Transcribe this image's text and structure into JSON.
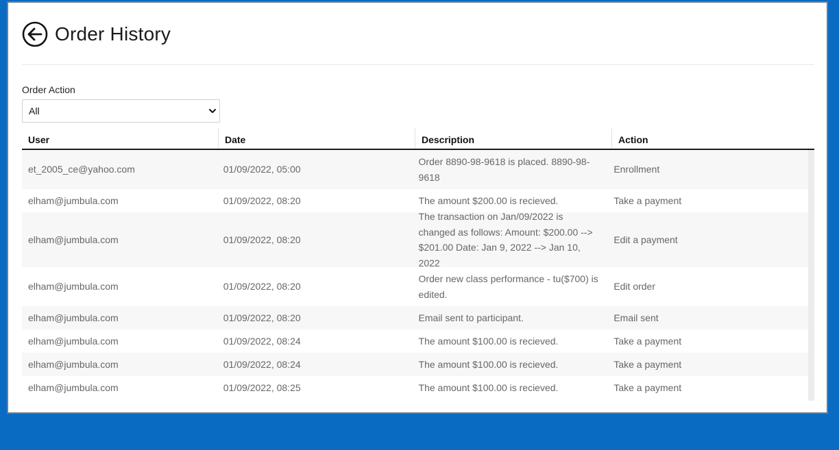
{
  "header": {
    "title": "Order History",
    "back_icon": "arrow-left-circle-icon"
  },
  "filter": {
    "label": "Order Action",
    "selected": "All"
  },
  "table": {
    "columns": [
      "User",
      "Date",
      "Description",
      "Action"
    ],
    "rows": [
      {
        "user": "et_2005_ce@yahoo.com",
        "date": "01/09/2022, 05:00",
        "description": "Order 8890-98-9618 is placed. 8890-98-9618",
        "action": "Enrollment"
      },
      {
        "user": "elham@jumbula.com",
        "date": "01/09/2022, 08:20",
        "description": "The amount $200.00 is recieved.",
        "action": "Take a payment"
      },
      {
        "user": "elham@jumbula.com",
        "date": "01/09/2022, 08:20",
        "description": "The transaction on Jan/09/2022 is changed as follows: Amount: $200.00 --> $201.00 Date: Jan 9, 2022 --> Jan 10, 2022",
        "action": "Edit a payment"
      },
      {
        "user": "elham@jumbula.com",
        "date": "01/09/2022, 08:20",
        "description": "Order new class performance - tu($700) is edited.",
        "action": "Edit order"
      },
      {
        "user": "elham@jumbula.com",
        "date": "01/09/2022, 08:20",
        "description": "Email sent to participant.",
        "action": "Email sent"
      },
      {
        "user": "elham@jumbula.com",
        "date": "01/09/2022, 08:24",
        "description": "The amount $100.00 is recieved.",
        "action": "Take a payment"
      },
      {
        "user": "elham@jumbula.com",
        "date": "01/09/2022, 08:24",
        "description": "The amount $100.00 is recieved.",
        "action": "Take a payment"
      },
      {
        "user": "elham@jumbula.com",
        "date": "01/09/2022, 08:25",
        "description": "The amount $100.00 is recieved.",
        "action": "Take a payment"
      }
    ]
  },
  "colors": {
    "page_background": "#0a6bc2",
    "modal_background": "#ffffff",
    "row_alt": "#f7f7f7",
    "header_border": "#1a1a1a",
    "cell_text": "#666666"
  }
}
